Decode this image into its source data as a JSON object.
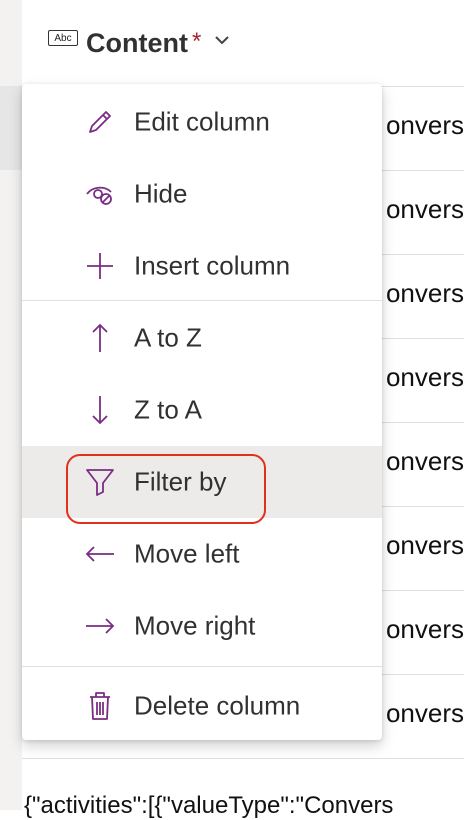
{
  "header": {
    "type_icon_text": "Abc",
    "title": "Content",
    "required_mark": "*"
  },
  "rows": [
    {
      "text": "onvers"
    },
    {
      "text": "onvers"
    },
    {
      "text": "onvers"
    },
    {
      "text": "onvers"
    },
    {
      "text": "onvers"
    },
    {
      "text": "onvers"
    },
    {
      "text": "onvers"
    },
    {
      "text": "onvers"
    }
  ],
  "last_row_text": "{\"activities\":[{\"valueType\":\"Convers",
  "menu": {
    "edit": "Edit column",
    "hide": "Hide",
    "insert": "Insert column",
    "a_to_z": "A to Z",
    "z_to_a": "Z to A",
    "filter": "Filter by",
    "move_left": "Move left",
    "move_right": "Move right",
    "delete": "Delete column"
  },
  "colors": {
    "icon": "#7a2d84",
    "highlight_border": "#e0301e",
    "required": "#a4262c"
  }
}
